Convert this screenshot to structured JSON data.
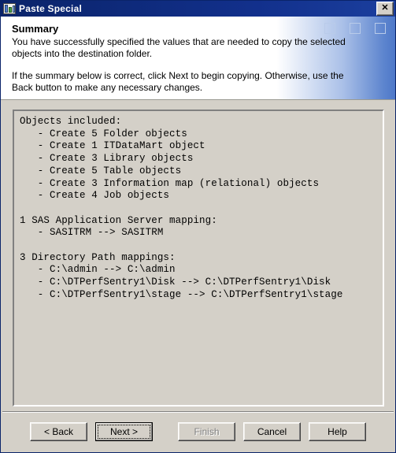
{
  "window": {
    "title": "Paste Special",
    "icon": "paste-special-icon",
    "close_label": "✕"
  },
  "header": {
    "title": "Summary",
    "paragraph1": "You have successfully specified the values that are needed to copy the selected objects into the destination folder.",
    "paragraph2": "If the summary below is correct, click Next to begin copying.  Otherwise, use the Back button to make any necessary changes.",
    "decoration_squares": 3
  },
  "summary": {
    "lines": [
      "Objects included:",
      "   - Create 5 Folder objects",
      "   - Create 1 ITDataMart object",
      "   - Create 3 Library objects",
      "   - Create 5 Table objects",
      "   - Create 3 Information map (relational) objects",
      "   - Create 4 Job objects",
      "",
      "1 SAS Application Server mapping:",
      "   - SASITRM --> SASITRM",
      "",
      "3 Directory Path mappings:",
      "   - C:\\admin --> C:\\admin",
      "   - C:\\DTPerfSentry1\\Disk --> C:\\DTPerfSentry1\\Disk",
      "   - C:\\DTPerfSentry1\\stage --> C:\\DTPerfSentry1\\stage"
    ],
    "text": "Objects included:\n   - Create 5 Folder objects\n   - Create 1 ITDataMart object\n   - Create 3 Library objects\n   - Create 5 Table objects\n   - Create 3 Information map (relational) objects\n   - Create 4 Job objects\n\n1 SAS Application Server mapping:\n   - SASITRM --> SASITRM\n\n3 Directory Path mappings:\n   - C:\\admin --> C:\\admin\n   - C:\\DTPerfSentry1\\Disk --> C:\\DTPerfSentry1\\Disk\n   - C:\\DTPerfSentry1\\stage --> C:\\DTPerfSentry1\\stage"
  },
  "buttons": {
    "back": "< Back",
    "next": "Next >",
    "finish": "Finish",
    "cancel": "Cancel",
    "help": "Help"
  },
  "colors": {
    "titlebar_start": "#0a246a",
    "titlebar_end": "#1b3f9e",
    "dialog_face": "#d4d0c8",
    "header_bg": "#ffffff",
    "gradient_blue": "#4e78c8",
    "square_outline": "#b9cbe9",
    "disabled_text": "#808080"
  }
}
